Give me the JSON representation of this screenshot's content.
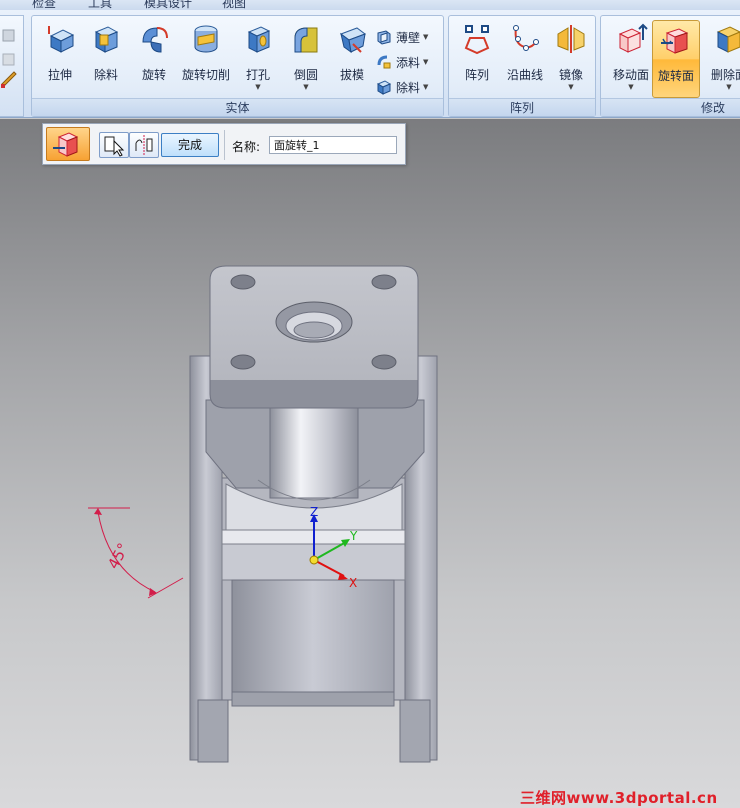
{
  "ribbon": {
    "tabs": [
      "检查",
      "工具",
      "模具设计",
      "视图"
    ],
    "groups": {
      "solid": {
        "label": "实体",
        "extrude": "拉伸",
        "cut": "除料",
        "revolve": "旋转",
        "revolve_cut": "旋转切削",
        "hole": "打孔",
        "round": "倒圆",
        "draft": "拔模",
        "thin_wall": "薄壁",
        "add_material": "添料",
        "remove_material": "除料"
      },
      "pattern": {
        "label": "阵列",
        "pattern": "阵列",
        "along_curve": "沿曲线",
        "mirror": "镜像"
      },
      "modify": {
        "label": "修改",
        "move_face": "移动面",
        "rotate_face": "旋转面",
        "delete_face": "删除面"
      }
    }
  },
  "command_bar": {
    "done_label": "完成",
    "name_label": "名称:",
    "name_value": "面旋转_1"
  },
  "viewport": {
    "angle_label": "45°",
    "axis_x": "X",
    "axis_y": "Y",
    "axis_z": "Z",
    "axis_colors": {
      "x": "#e01010",
      "y": "#1fb81f",
      "z": "#1020d0"
    },
    "dimension_color": "#d21d4a"
  },
  "watermark": "三维网www.3dportal.cn"
}
